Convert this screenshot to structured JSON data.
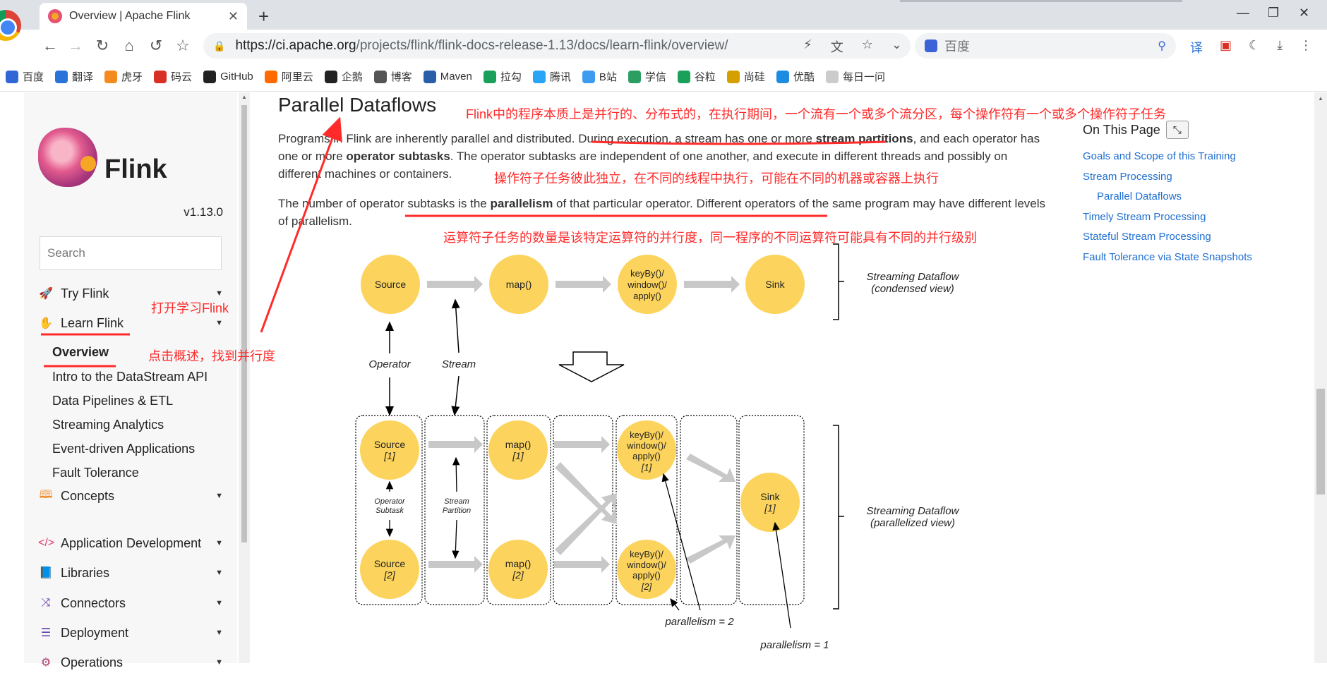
{
  "browser": {
    "tab_title": "Overview | Apache Flink",
    "tab_close": "✕",
    "new_tab": "+",
    "url_host": "https://ci.apache.org",
    "url_path": "/projects/flink/flink-docs-release-1.13/docs/learn-flink/overview/",
    "search_placeholder": "百度",
    "bookmarks": [
      "百度",
      "翻译",
      "虎牙",
      "码云",
      "GitHub",
      "阿里云",
      "企鹅",
      "博客",
      "Maven",
      "拉勾",
      "腾讯",
      "B站",
      "学信",
      "谷粒",
      "尚硅",
      "优酷",
      "每日一问"
    ],
    "bookmark_colors": [
      "#3166d6",
      "#2a73d9",
      "#f58a1f",
      "#d93025",
      "#222222",
      "#ff6a00",
      "#222222",
      "#555555",
      "#2b5ea8",
      "#1aa05a",
      "#2aa4f4",
      "#3d9bf0",
      "#2c9e61",
      "#1aa05a",
      "#d4a000",
      "#1c8ce3",
      "#cccccc"
    ]
  },
  "sidebar": {
    "logo_text": "Flink",
    "version": "v1.13.0",
    "search_placeholder": "Search",
    "items": [
      {
        "label": "Try Flink",
        "icon": "rocket-icon"
      },
      {
        "label": "Learn Flink",
        "icon": "hand-icon"
      },
      {
        "label": "Concepts",
        "icon": "map-icon"
      },
      {
        "label": "Application Development",
        "icon": "code-icon"
      },
      {
        "label": "Libraries",
        "icon": "book-icon"
      },
      {
        "label": "Connectors",
        "icon": "shuffle-icon"
      },
      {
        "label": "Deployment",
        "icon": "sliders-icon"
      },
      {
        "label": "Operations",
        "icon": "gear-icon"
      }
    ],
    "subitems": [
      "Overview",
      "Intro to the DataStream API",
      "Data Pipelines & ETL",
      "Streaming Analytics",
      "Event-driven Applications",
      "Fault Tolerance"
    ]
  },
  "content": {
    "title": "Parallel Dataflows",
    "p1_a": "Programs in Flink are inherently parallel and distributed. During execution, a stream has one or more ",
    "p1_b": "stream partitions",
    "p1_c": ", and each operator has one or more ",
    "p1_d": "operator subtasks",
    "p1_e": ". The operator subtasks are independent of one another, and execute in different threads and possibly on different machines or containers.",
    "p2_a": "The number of operator subtasks is the ",
    "p2_b": "parallelism",
    "p2_c": " of that particular operator. Different operators of the same program may have different levels of parallelism."
  },
  "toc": {
    "title": "On This Page",
    "links": [
      "Goals and Scope of this Training",
      "Stream Processing",
      "Parallel Dataflows",
      "Timely Stream Processing",
      "Stateful Stream Processing",
      "Fault Tolerance via State Snapshots"
    ]
  },
  "annotations": {
    "a1": "Flink中的程序本质上是并行的、分布式的，在执行期间，一个流有一个或多个流分区，每个操作符有一个或多个操作符子任务",
    "a2": "操作符子任务彼此独立，在不同的线程中执行，可能在不同的机器或容器上执行",
    "a3": "运算符子任务的数量是该特定运算符的并行度，同一程序的不同运算符可能具有不同的并行级别",
    "a4": "打开学习Flink",
    "a5": "点击概述，找到并行度"
  },
  "diagram": {
    "condensed": [
      "Source",
      "map()",
      "keyBy()/",
      "window()/",
      "apply()",
      "Sink"
    ],
    "parallel": {
      "source1": "Source",
      "sub1": "[1]",
      "source2": "Source",
      "sub2": "[2]",
      "map": "map()",
      "sink": "Sink"
    },
    "labels": {
      "operator": "Operator",
      "stream": "Stream",
      "operator_subtask_1": "Operator",
      "operator_subtask_2": "Subtask",
      "stream_partition_1": "Stream",
      "stream_partition_2": "Partition",
      "condensed_1": "Streaming Dataflow",
      "condensed_2": "(condensed view)",
      "parallel_1": "Streaming Dataflow",
      "parallel_2": "(parallelized view)",
      "parallelism2": "parallelism = 2",
      "parallelism1": "parallelism = 1"
    }
  }
}
